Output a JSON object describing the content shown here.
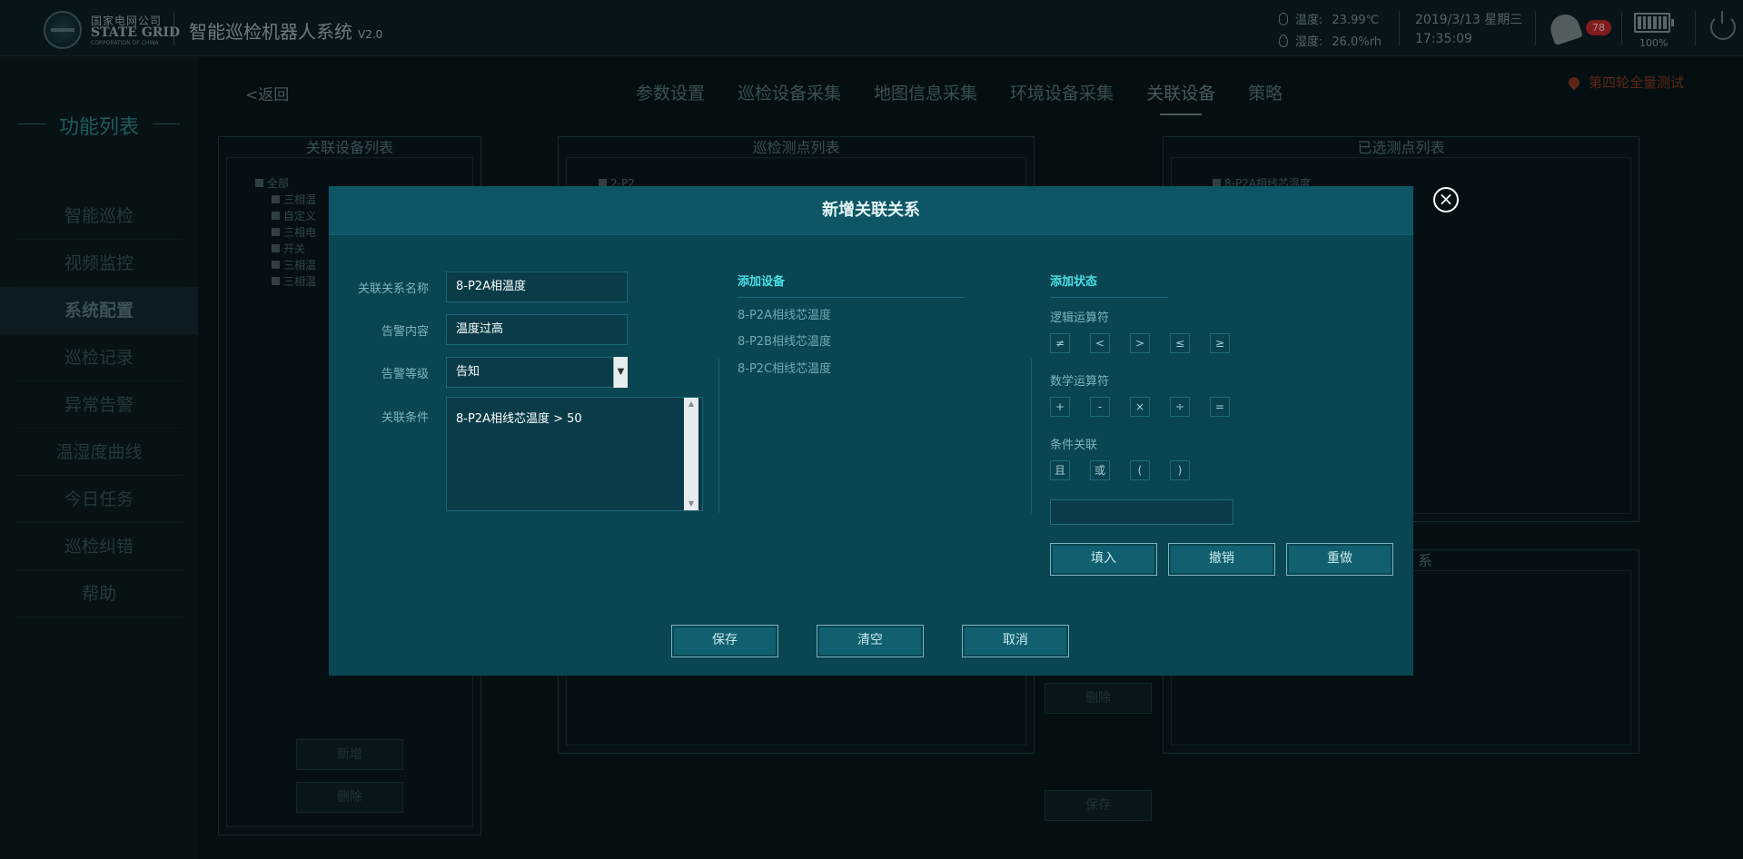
{
  "header": {
    "logo_cn": "国家电网公司",
    "logo_en": "STATE GRID",
    "logo_sub": "CORPORATION OF CHINA",
    "app_title": "智能巡检机器人系统",
    "app_version": "V2.0",
    "temperature_label": "温度:",
    "temperature_value": "23.99℃",
    "humidity_label": "湿度:",
    "humidity_value": "26.0%rh",
    "date": "2019/3/13 星期三",
    "time": "17:35:09",
    "alarm_count": "78",
    "battery_label": "100%",
    "battery_level": 1.0
  },
  "sidebar": {
    "title": "功能列表",
    "items": [
      {
        "label": "智能巡检"
      },
      {
        "label": "视频监控"
      },
      {
        "label": "系统配置"
      },
      {
        "label": "巡检记录"
      },
      {
        "label": "异常告警"
      },
      {
        "label": "温湿度曲线"
      },
      {
        "label": "今日任务"
      },
      {
        "label": "巡检纠错"
      },
      {
        "label": "帮助"
      }
    ],
    "active_index": 2
  },
  "main": {
    "back_label": "<返回",
    "tabs": [
      {
        "label": "参数设置"
      },
      {
        "label": "巡检设备采集"
      },
      {
        "label": "地图信息采集"
      },
      {
        "label": "环境设备采集"
      },
      {
        "label": "关联设备"
      },
      {
        "label": "策略"
      }
    ],
    "active_tab": 4,
    "location_label": "第四轮全量测试",
    "panel_left_title": "关联设备列表",
    "panel_mid_title": "巡检测点列表",
    "panel_right_title": "已选测点列表",
    "panel_right_bottom_partial": "系",
    "tree_left": [
      "全部",
      "三相温",
      "自定义",
      "三相电",
      "开关",
      "三相温",
      "三相温"
    ],
    "tree_mid": [
      "2-P2"
    ],
    "tree_right": [
      "8-P2A相线芯温度"
    ],
    "add_button": "新增",
    "delete_button": "删除",
    "mid_delete_button": "删除",
    "mid_save_button": "保存"
  },
  "modal": {
    "title": "新增关联关系",
    "fields": {
      "name_label": "关联关系名称",
      "name_value": "8-P2A相温度",
      "alarm_content_label": "告警内容",
      "alarm_content_value": "温度过高",
      "alarm_level_label": "告警等级",
      "alarm_level_value": "告知",
      "condition_label": "关联条件",
      "condition_value": "8-P2A相线芯温度 > 50"
    },
    "add_device": {
      "title": "添加设备",
      "items": [
        "8-P2A相线芯温度",
        "8-P2B相线芯温度",
        "8-P2C相线芯温度"
      ]
    },
    "add_state": {
      "title": "添加状态",
      "logic_label": "逻辑运算符",
      "logic_ops": [
        "≠",
        "<",
        ">",
        "≤",
        "≥"
      ],
      "math_label": "数学运算符",
      "math_ops": [
        "+",
        "-",
        "×",
        "÷",
        "="
      ],
      "cond_label": "条件关联",
      "cond_ops": [
        "且",
        "或",
        "(",
        ")"
      ],
      "fill_button": "填入",
      "undo_button": "撤销",
      "redo_button": "重做"
    },
    "save_button": "保存",
    "clear_button": "清空",
    "cancel_button": "取消"
  }
}
